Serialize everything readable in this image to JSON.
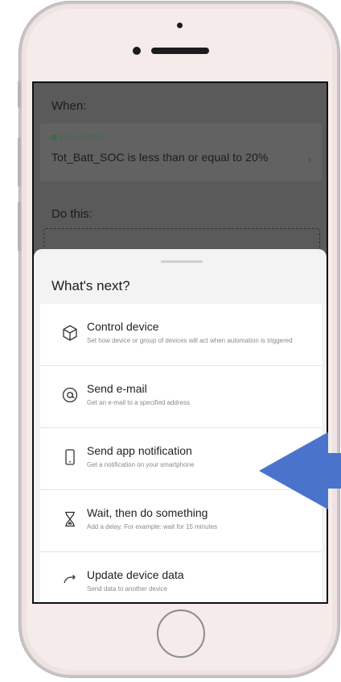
{
  "automation": {
    "when_label": "When:",
    "condition": {
      "device": "ECU SA 02369",
      "text": "Tot_Batt_SOC is less than or equal to 20%",
      "chevron": "›"
    },
    "do_label": "Do this:"
  },
  "sheet": {
    "title": "What's next?",
    "items": [
      {
        "icon": "cube-icon",
        "title": "Control device",
        "description": "Set how device or group of devices will act when automation is triggered"
      },
      {
        "icon": "at-sign-icon",
        "title": "Send e-mail",
        "description": "Get an e-mail to a specified address"
      },
      {
        "icon": "smartphone-icon",
        "title": "Send app notification",
        "description": "Get a notification on your smartphone"
      },
      {
        "icon": "hourglass-icon",
        "title": "Wait, then do something",
        "description": "Add a delay. For example: wait for 15 minutes"
      },
      {
        "icon": "refresh-icon",
        "title": "Update device data",
        "description": "Send data to another device"
      }
    ]
  },
  "colors": {
    "overlay": "#4a4a4a",
    "sheet": "#f3f3f3",
    "device_tag": "#3e6b4a",
    "arrow": "#4a74cc"
  }
}
